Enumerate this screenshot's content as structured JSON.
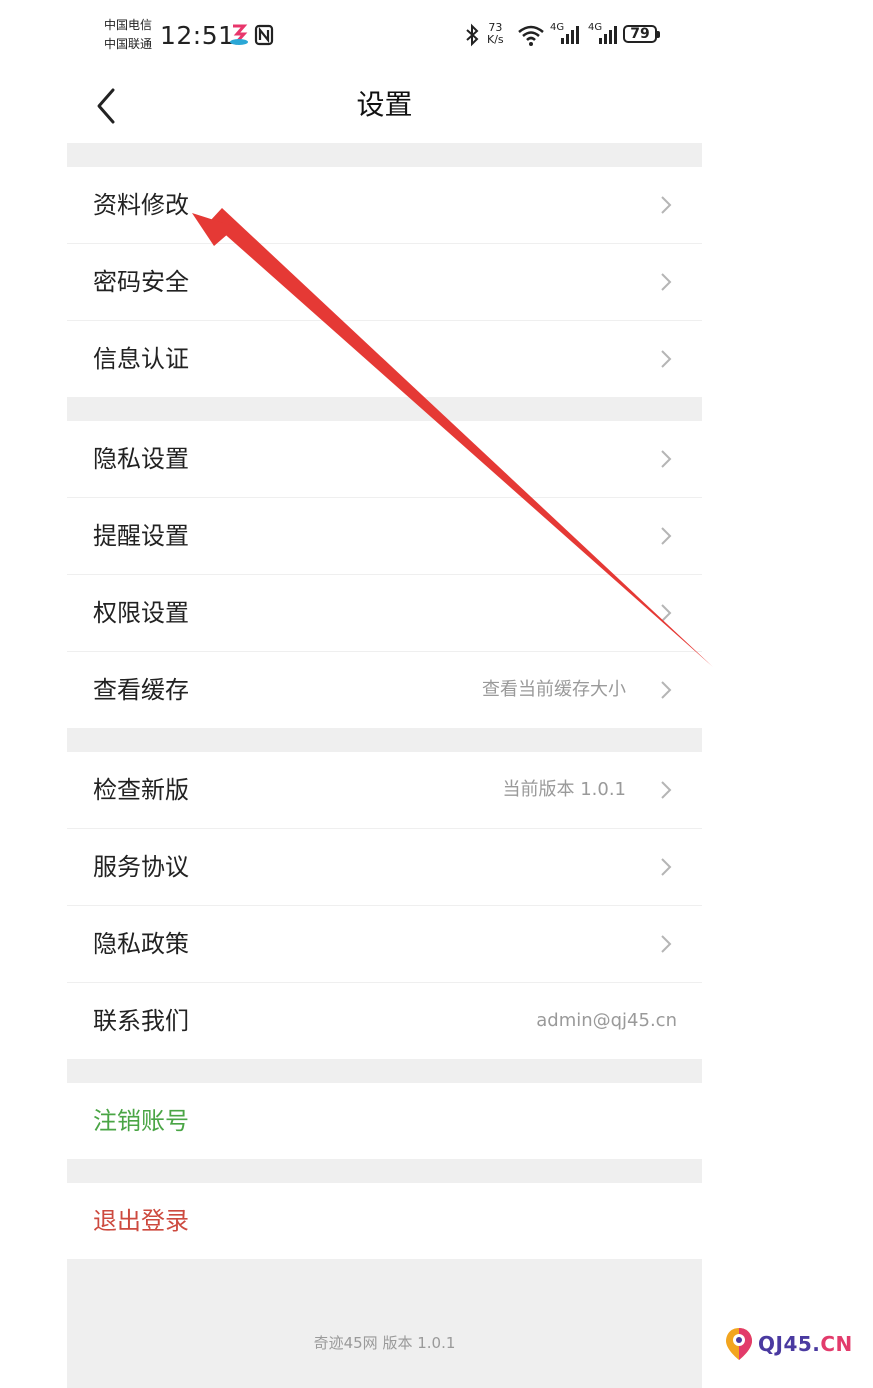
{
  "status_bar": {
    "carrier_1": "中国电信",
    "carrier_2": "中国联通",
    "time": "12:51",
    "speed_value": "73",
    "speed_unit": "K/s",
    "network_1": "4G",
    "network_2": "4G",
    "battery": "79"
  },
  "header": {
    "title": "设置"
  },
  "sections": [
    {
      "items": [
        {
          "label": "资料修改"
        },
        {
          "label": "密码安全"
        },
        {
          "label": "信息认证"
        }
      ]
    },
    {
      "items": [
        {
          "label": "隐私设置"
        },
        {
          "label": "提醒设置"
        },
        {
          "label": "权限设置"
        },
        {
          "label": "查看缓存",
          "value": "查看当前缓存大小"
        }
      ]
    },
    {
      "items": [
        {
          "label": "检查新版",
          "value": "当前版本 1.0.1"
        },
        {
          "label": "服务协议"
        },
        {
          "label": "隐私政策"
        },
        {
          "label": "联系我们",
          "value": "admin@qj45.cn"
        }
      ]
    },
    {
      "items": [
        {
          "label": "注销账号"
        }
      ]
    },
    {
      "items": [
        {
          "label": "退出登录"
        }
      ]
    }
  ],
  "footer": {
    "version_text": "奇迹45网 版本 1.0.1"
  },
  "watermark": {
    "text_main": "QJ45.",
    "text_suffix": "CN"
  },
  "colors": {
    "accent_green": "#4aa545",
    "danger_red": "#cd4a3f",
    "annotation_red": "#e53935",
    "divider": "#efefef"
  }
}
